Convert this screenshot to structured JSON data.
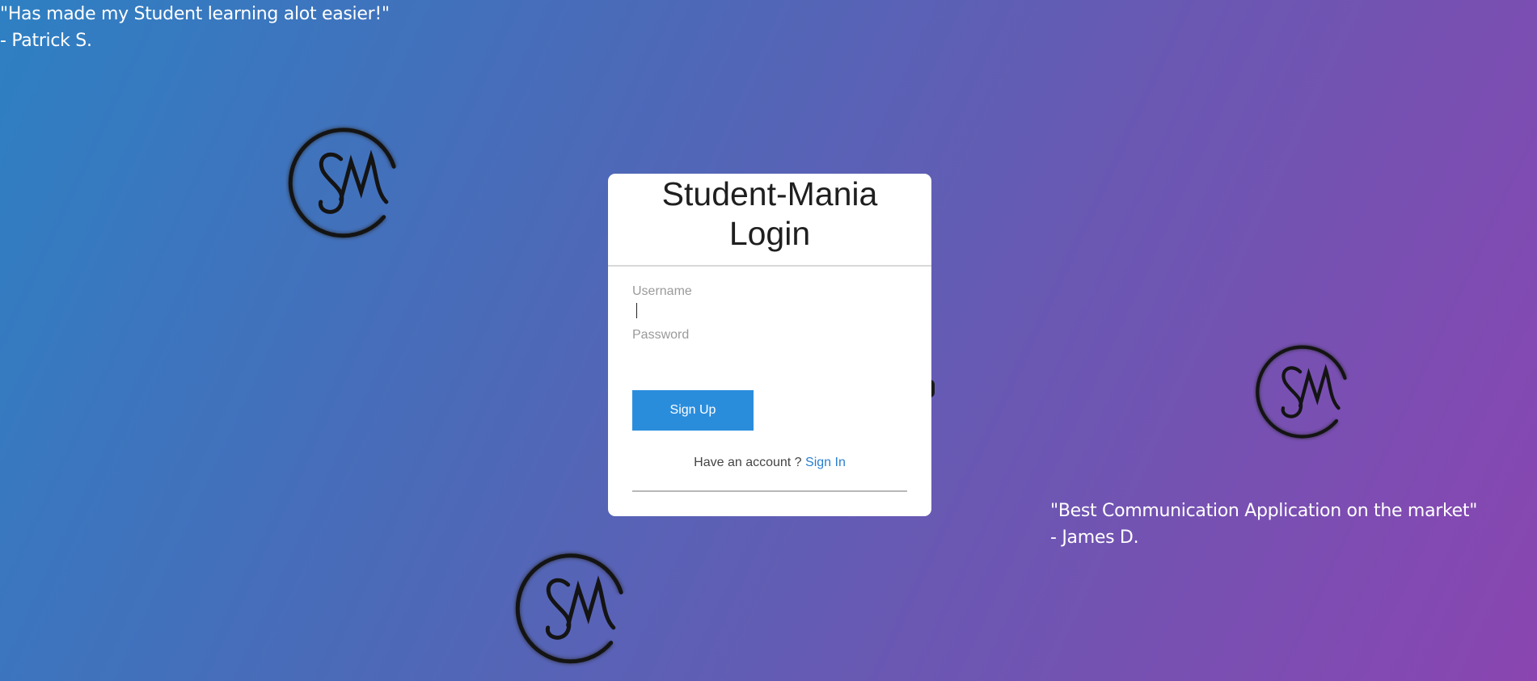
{
  "testimonials": [
    {
      "quote": "\"Has made my Student learning alot easier!\"",
      "author": "- Patrick S."
    },
    {
      "quote": "\"Best Communication Application on the market\"",
      "author": "- James D."
    }
  ],
  "logo": {
    "icon": "sm-logo-icon",
    "color": "#141414"
  },
  "login": {
    "title_line1": "Student-Mania",
    "title_line2": "Login",
    "username_label": "Username",
    "username_value": "",
    "password_label": "Password",
    "password_value": "",
    "signup_label": "Sign Up",
    "account_prompt": "Have an account ? ",
    "signin_label": "Sign In"
  },
  "colors": {
    "gradient_start": "#2e80c3",
    "gradient_end": "#8a45b1",
    "button": "#2a8ddc",
    "link": "#2a7fd0"
  }
}
